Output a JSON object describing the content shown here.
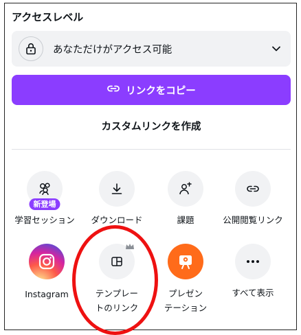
{
  "access": {
    "title": "アクセスレベル",
    "selected": "あなただけがアクセス可能"
  },
  "buttons": {
    "copy_link": "リンクをコピー",
    "custom_link": "カスタムリンクを作成"
  },
  "colors": {
    "accent": "#8b3dff",
    "highlight": "#ee1111",
    "present": "#ff6b1a"
  },
  "options": {
    "learning_session": {
      "label": "学習セッション",
      "badge": "新登場",
      "icon": "people-group-icon"
    },
    "download": {
      "label": "ダウンロード",
      "icon": "download-icon"
    },
    "assignment": {
      "label": "課題",
      "icon": "assignment-icon"
    },
    "public_link": {
      "label": "公開閲覧リンク",
      "icon": "link-icon"
    },
    "instagram": {
      "label": "Instagram",
      "icon": "instagram-icon"
    },
    "template_link": {
      "label_line1": "テンプレー",
      "label_line2": "トのリンク",
      "icon": "template-icon"
    },
    "presentation": {
      "label_line1": "プレゼン",
      "label_line2": "テーション",
      "icon": "presentation-icon"
    },
    "show_all": {
      "label": "すべて表示",
      "icon": "more-icon"
    }
  }
}
